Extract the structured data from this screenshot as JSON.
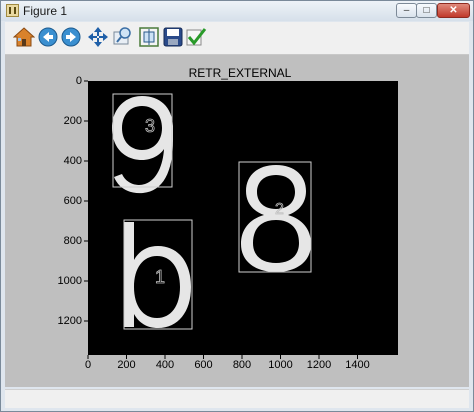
{
  "window": {
    "title": "Figure 1",
    "minimize_glyph": "–",
    "maximize_glyph": "□",
    "close_glyph": "✕"
  },
  "toolbar": {
    "tools": [
      {
        "name": "home-icon"
      },
      {
        "name": "back-icon"
      },
      {
        "name": "forward-icon"
      },
      {
        "name": "pan-icon"
      },
      {
        "name": "zoom-icon"
      },
      {
        "name": "configure-subplots-icon"
      },
      {
        "name": "save-icon"
      },
      {
        "name": "edit-check-icon"
      }
    ]
  },
  "plot": {
    "title": "RETR_EXTERNAL",
    "y_ticks": [
      "0",
      "200",
      "400",
      "600",
      "800",
      "1000",
      "1200"
    ],
    "x_ticks": [
      "0",
      "200",
      "400",
      "600",
      "800",
      "1000",
      "1200",
      "1400"
    ],
    "digits": [
      "9",
      "8",
      "b"
    ],
    "contour_labels": [
      "3",
      "2",
      "1"
    ],
    "colors": {
      "background": "#000000",
      "glyph": "#e6e6e6",
      "frame_bg": "#bfbfbf"
    }
  }
}
